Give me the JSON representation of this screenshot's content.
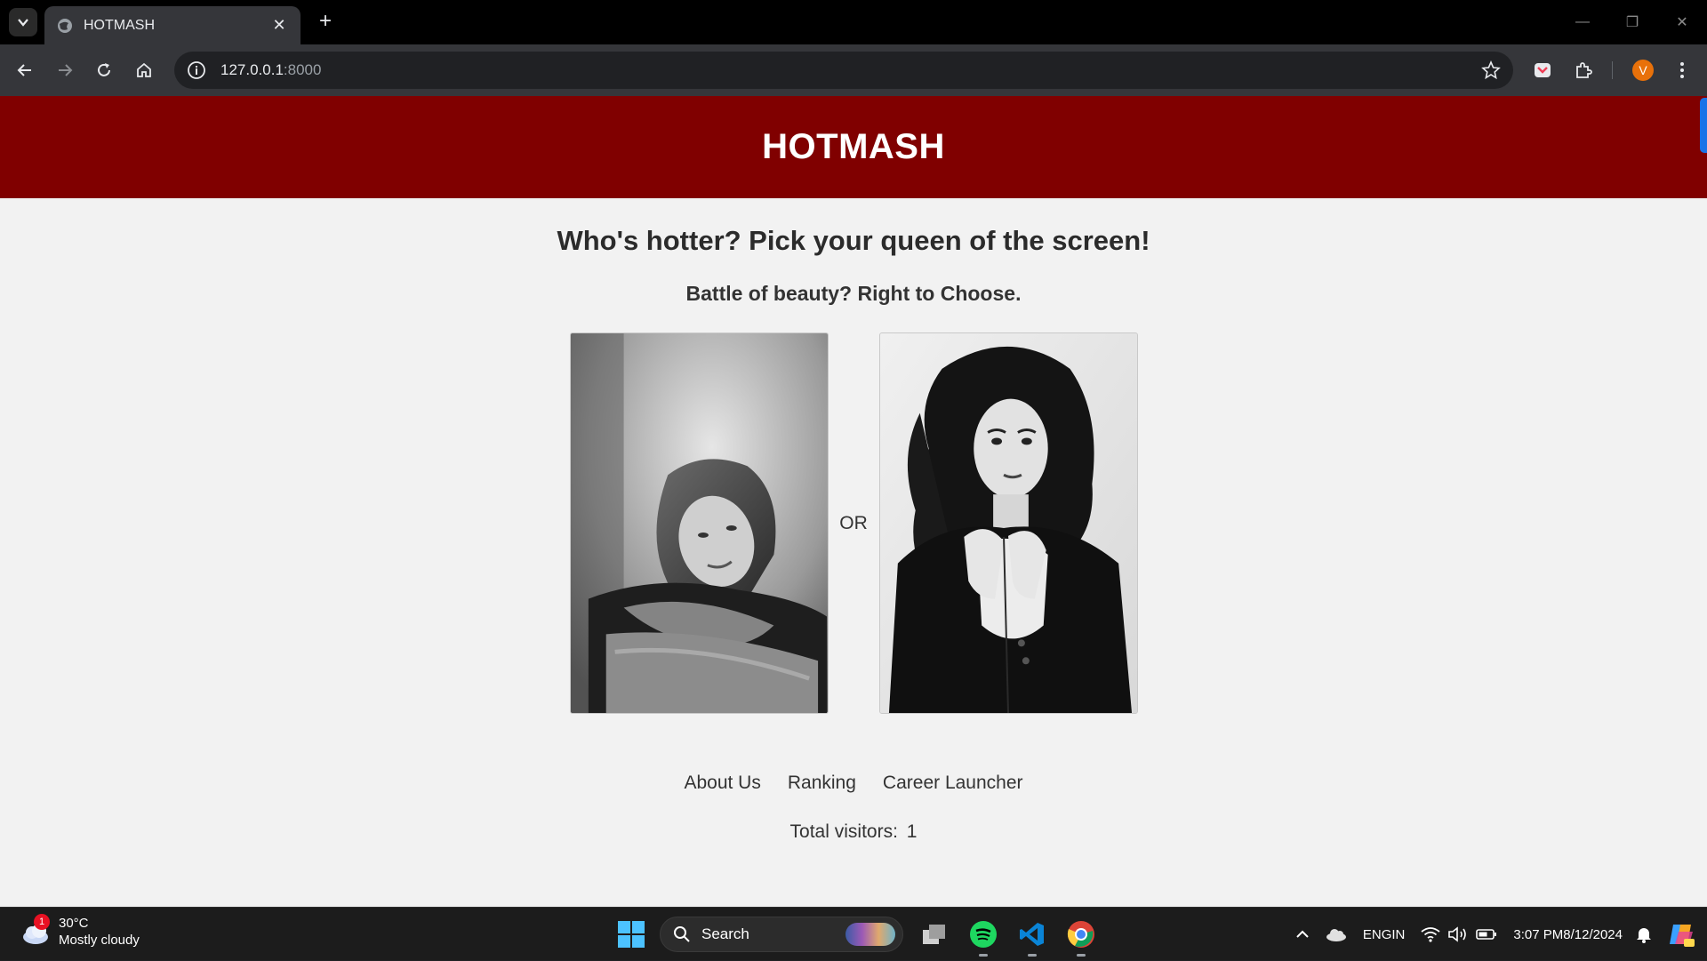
{
  "browser": {
    "tab_title": "HOTMASH",
    "url_host": "127.0.0.1",
    "url_port": ":8000",
    "profile_initial": "V"
  },
  "page": {
    "site_title": "HOTMASH",
    "headline": "Who's hotter? Pick your queen of the screen!",
    "subheadline": "Battle of beauty? Right to Choose.",
    "or_label": "OR",
    "footer_links": [
      "About Us",
      "Ranking",
      "Career Launcher"
    ],
    "visitors_label": "Total visitors:",
    "visitors_count": "1",
    "colors": {
      "header_bg": "#800000",
      "page_bg": "#f2f2f2"
    }
  },
  "taskbar": {
    "weather_temp": "30°C",
    "weather_desc": "Mostly cloudy",
    "weather_badge": "1",
    "search_placeholder": "Search",
    "lang_line1": "ENG",
    "lang_line2": "IN",
    "time": "3:07 PM",
    "date": "8/12/2024"
  }
}
